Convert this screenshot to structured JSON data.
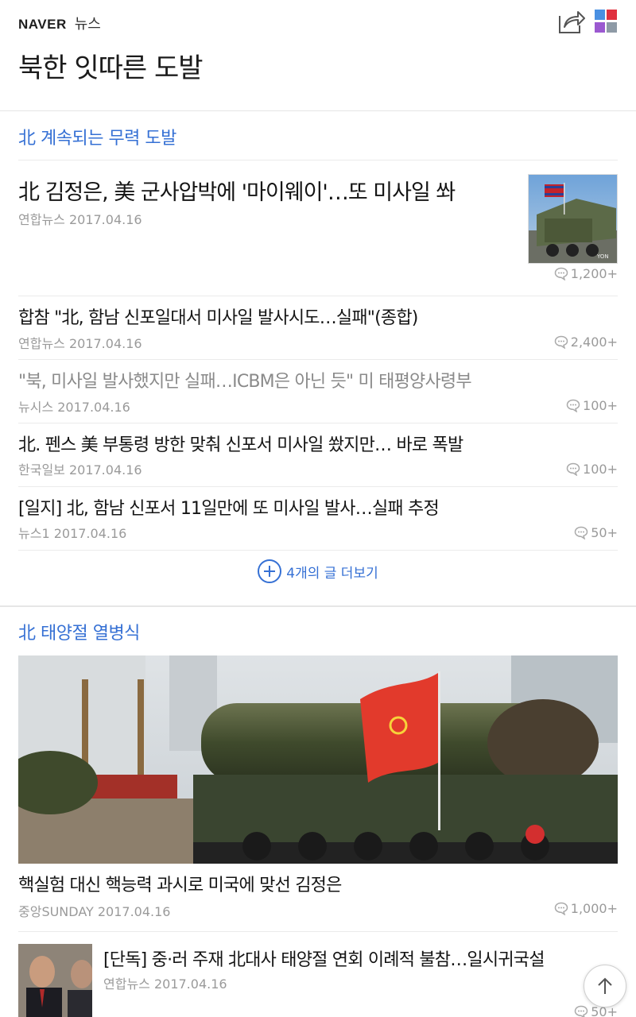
{
  "header": {
    "brand": "NAVER",
    "brand_sub": "뉴스",
    "page_title": "북한 잇따른 도발",
    "share_icon": "share-icon",
    "menu_icon": "grid-menu-icon",
    "grid_colors": [
      "#4a90e2",
      "#e0313f",
      "#9b59d0",
      "#8e9aa6"
    ]
  },
  "section1": {
    "title": "北 계속되는 무력 도발",
    "articles": [
      {
        "title": "北 김정은, 美 군사압박에 '마이웨이'…또 미사일 쏴",
        "source": "연합뉴스 2017.04.16",
        "comments": "1,200+"
      },
      {
        "title": "합참 \"北, 함남 신포일대서 미사일 발사시도…실패\"(종합)",
        "source": "연합뉴스 2017.04.16",
        "comments": "2,400+"
      },
      {
        "title": "\"북, 미사일 발사했지만 실패…ICBM은 아닌 듯\" 미 태평양사령부",
        "source": "뉴시스 2017.04.16",
        "comments": "100+"
      },
      {
        "title": "北. 펜스 美 부통령 방한 맞춰 신포서 미사일 쐈지만… 바로 폭발",
        "source": "한국일보 2017.04.16",
        "comments": "100+"
      },
      {
        "title": "[일지] 北, 함남 신포서 11일만에 또 미사일 발사…실패 추정",
        "source": "뉴스1 2017.04.16",
        "comments": "50+"
      }
    ],
    "more_label": "4개의 글 더보기"
  },
  "section2": {
    "title": "北 태양절 열병식",
    "articles": [
      {
        "title": "핵실험 대신 핵능력 과시로 미국에 맞선 김정은",
        "source": "중앙SUNDAY 2017.04.16",
        "comments": "1,000+"
      },
      {
        "title": "[단독] 중·러 주재 北대사 태양절 연회 이례적 불참…일시귀국설",
        "source": "연합뉴스 2017.04.16",
        "comments": "50+"
      }
    ]
  },
  "colors": {
    "accent": "#3570d4",
    "meta": "#9a9a9a"
  },
  "icons": {
    "comment": "comment-bubble-icon",
    "more": "plus-circle-icon",
    "top": "arrow-up-icon"
  }
}
